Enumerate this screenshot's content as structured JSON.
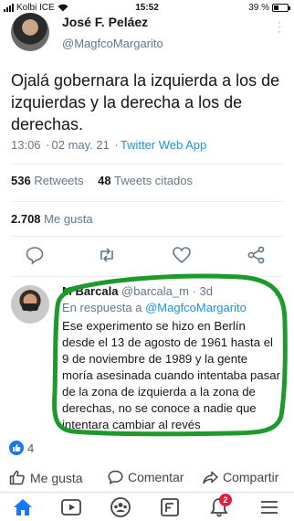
{
  "status_bar": {
    "carrier": "Kolbi ICE",
    "time": "15:52",
    "battery_text": "39 %",
    "battery_level": 0.39
  },
  "tweet": {
    "author_name": "José F. Peláez",
    "author_handle": "@MagfcoMargarito",
    "text": "Ojalá gobernara la izquierda a los de izquierdas y la derecha a los de derechas.",
    "time": "13:06",
    "date": "02 may. 21",
    "separator": "·",
    "app": "Twitter Web App",
    "retweets_count": "536",
    "retweets_label": "Retweets",
    "quotes_count": "48",
    "quotes_label": "Tweets citados",
    "likes_count": "2.708",
    "likes_label": "Me gusta"
  },
  "reply": {
    "author_name": "M Barcala",
    "author_handle": "@barcala_m",
    "age": "3d",
    "in_reply_prefix": "En respuesta a",
    "in_reply_handle": "@MagfcoMargarito",
    "text": "Ese experimento se hizo en Berlín desde el 13 de agosto de 1961 hasta el 9 de noviembre de 1989 y la gente moría asesinada cuando intentaba pasar de la zona de izquierda a la zona de derechas, no se conoce a nadie que intentara cambiar al revés"
  },
  "facebook": {
    "reactions_count": "4",
    "like_label": "Me gusta",
    "comment_label": "Comentar",
    "share_label": "Compartir",
    "notifications_badge": "2"
  },
  "colors": {
    "twitter_blue": "#1b95e0",
    "muted": "#657786",
    "annotation_green": "#1e9a2c",
    "facebook_blue": "#1877f2",
    "badge_red": "#e41e3f"
  },
  "icons": [
    "wifi-icon",
    "alarm-icon",
    "reply-icon",
    "retweet-icon",
    "heart-icon",
    "share-icon",
    "like-icon",
    "comment-icon",
    "share-arrow-icon",
    "home-icon",
    "video-icon",
    "groups-icon",
    "pages-icon",
    "notifications-icon",
    "menu-icon"
  ]
}
